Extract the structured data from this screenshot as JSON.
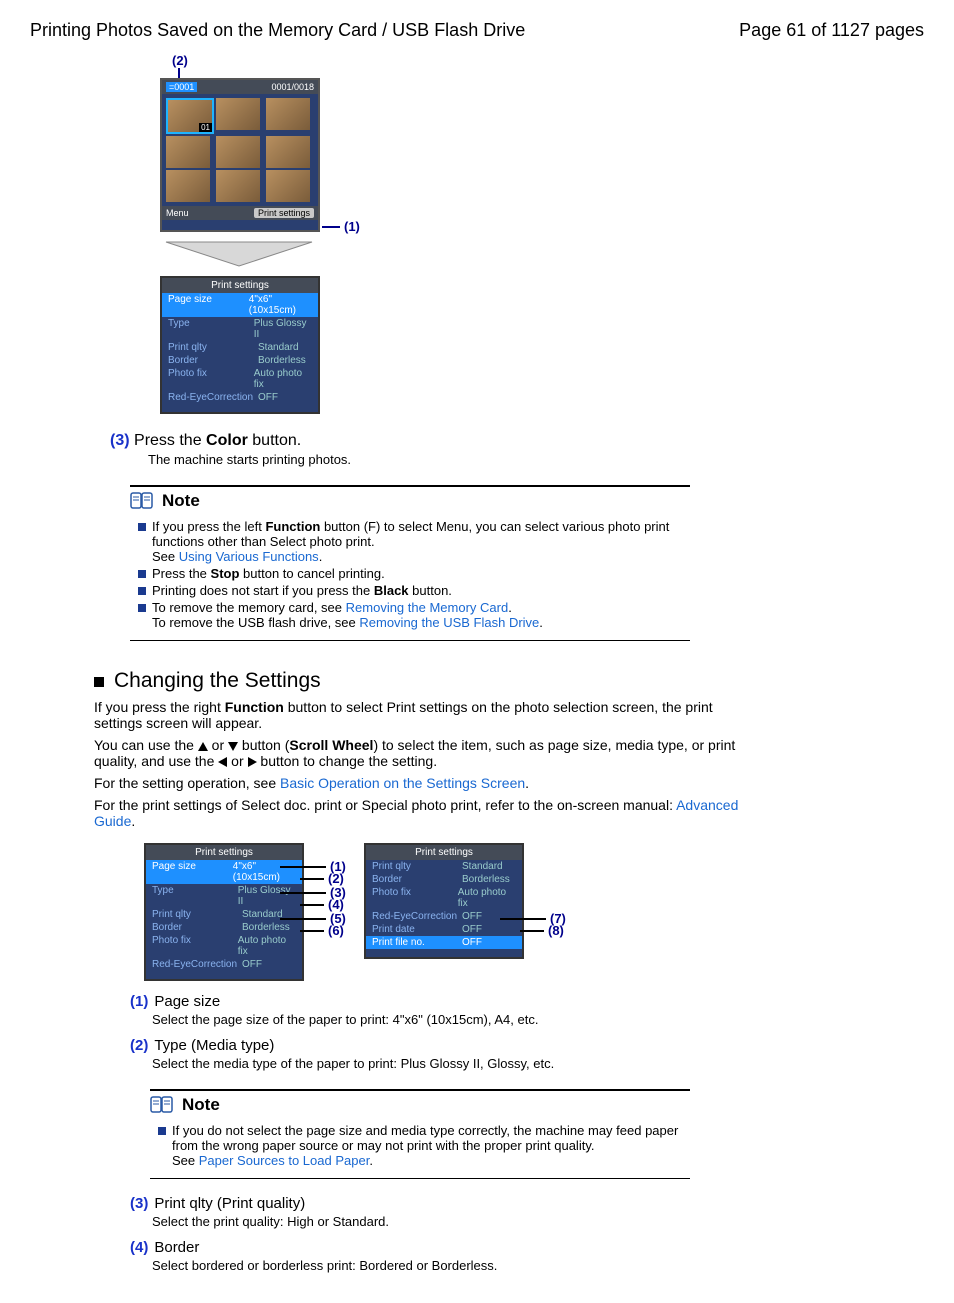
{
  "header": {
    "title": "Printing Photos Saved on the Memory Card / USB Flash Drive",
    "pg": "Page 61 of 1127 pages"
  },
  "fig1": {
    "callout2": "(2)",
    "callout1": "(1)",
    "count": "0001/0018",
    "idx": "=0001",
    "menu": "Menu",
    "ps": "Print settings",
    "thumbs": [
      "01",
      "",
      "",
      "",
      "",
      "",
      "",
      "",
      ""
    ]
  },
  "ps_panel": {
    "title": "Print settings",
    "rows": [
      {
        "l": "Page size",
        "v": "4\"x6\"(10x15cm)",
        "sel": true
      },
      {
        "l": "Type",
        "v": "Plus Glossy II"
      },
      {
        "l": "Print qlty",
        "v": "Standard"
      },
      {
        "l": "Border",
        "v": "Borderless"
      },
      {
        "l": "Photo fix",
        "v": "Auto photo fix"
      },
      {
        "l": "Red-EyeCorrection",
        "v": "OFF"
      }
    ]
  },
  "step3": {
    "num": "(3)",
    "a": "Press the ",
    "b": "Color",
    "c": " button.",
    "sub": "The machine starts printing photos."
  },
  "note1": {
    "title": "Note",
    "i1a": "If you press the left ",
    "i1b": "Function",
    "i1c": " button (F) to select Menu, you can select various photo print functions other than Select photo print.",
    "i1see": "See ",
    "i1link": "Using Various Functions",
    "dot": ".",
    "i2a": "Press the ",
    "i2b": "Stop",
    "i2c": " button to cancel printing.",
    "i3a": "Printing does not start if you press the ",
    "i3b": "Black",
    "i3c": " button.",
    "i4a": "To remove the memory card, see ",
    "i4link": "Removing the Memory Card",
    "i4b": "To remove the USB flash drive, see ",
    "i4link2": "Removing the USB Flash Drive"
  },
  "sec": {
    "title": "Changing the Settings",
    "p1a": "If you press the right ",
    "p1b": "Function",
    "p1c": " button to select Print settings on the photo selection screen, the print settings screen will appear.",
    "p2a": "You can use the ",
    "p2b": " or ",
    "p2c": " button (",
    "p2d": "Scroll Wheel",
    "p2e": ") to select the item, such as page size, media type, or print quality, and use the ",
    "p2f": " or ",
    "p2g": " button to change the setting.",
    "p3a": "For the setting operation, see ",
    "p3link": "Basic Operation on the Settings Screen",
    "p4a": "For the print settings of Select doc. print or Special photo print, refer to the on-screen manual: ",
    "p4link": "Advanced Guide"
  },
  "ps2": {
    "title": "Print settings",
    "rows": [
      {
        "l": "Print qlty",
        "v": "Standard"
      },
      {
        "l": "Border",
        "v": "Borderless"
      },
      {
        "l": "Photo fix",
        "v": "Auto photo fix"
      },
      {
        "l": "Red-EyeCorrection",
        "v": "OFF"
      },
      {
        "l": "Print date",
        "v": "OFF"
      },
      {
        "l": "Print file no.",
        "v": "OFF",
        "sel": true
      }
    ]
  },
  "pins1": [
    "(1)",
    "(2)",
    "(3)",
    "(4)",
    "(5)",
    "(6)"
  ],
  "pins2": [
    "(7)",
    "(8)"
  ],
  "defs": [
    {
      "n": "(1)",
      "t": "Page size",
      "d": "Select the page size of the paper to print: 4\"x6\" (10x15cm), A4, etc."
    },
    {
      "n": "(2)",
      "t": "Type (Media type)",
      "d": "Select the media type of the paper to print: Plus Glossy II, Glossy, etc."
    }
  ],
  "note2": {
    "title": "Note",
    "a": "If you do not select the page size and media type correctly, the machine may feed paper from the wrong paper source or may not print with the proper print quality.",
    "see": "See ",
    "link": "Paper Sources to Load Paper"
  },
  "defs2": [
    {
      "n": "(3)",
      "t": "Print qlty (Print quality)",
      "d": "Select the print quality: High or Standard."
    },
    {
      "n": "(4)",
      "t": "Border",
      "d": "Select bordered or borderless print: Bordered or Borderless."
    }
  ]
}
